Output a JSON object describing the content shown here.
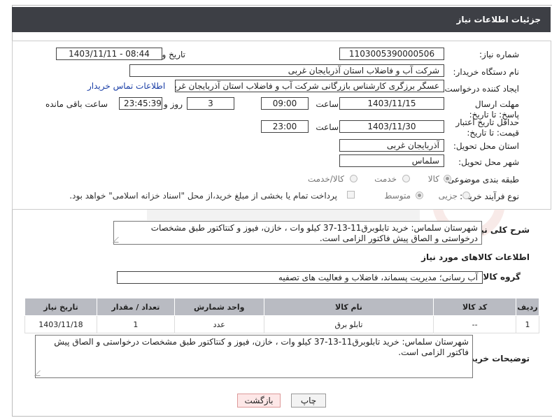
{
  "header": {
    "title": "جزئیات اطلاعات نیاز"
  },
  "form": {
    "need_number_label": "شماره نیاز:",
    "need_number": "1103005390000506",
    "announce_label": "تاریخ و ساعت اعلان عمومی:",
    "announce_value": "1403/11/11 - 08:44",
    "buyer_label": "نام دستگاه خریدار:",
    "buyer_value": "شرکت آب و فاضلاب استان آذربایجان غربی",
    "creator_label": "ایجاد کننده درخواست:",
    "creator_value": "عسگر  برزگری کارشناس بازرگانی شرکت آب و فاضلاب استان آذربایجان غربی",
    "contact_link": "اطلاعات تماس خریدار",
    "deadline_label": "مهلت ارسال پاسخ: تا تاریخ:",
    "deadline_date": "1403/11/15",
    "time_label": "ساعت",
    "deadline_time": "09:00",
    "days_value": "3",
    "days_label": "روز و",
    "remaining_time": "23:45:39",
    "remaining_label": "ساعت باقی مانده",
    "validity_label": "حداقل تاریخ اعتبار قیمت: تا تاریخ:",
    "validity_date": "1403/11/30",
    "validity_time": "23:00",
    "province_label": "استان محل تحویل:",
    "province_value": "آذربایجان غربی",
    "city_label": "شهر محل تحویل:",
    "city_value": "سلماس",
    "category_label": "طبقه بندی موضوعی:",
    "category_options": [
      "کالا",
      "خدمت",
      "کالا/خدمت"
    ],
    "process_label": "نوع فرآیند خرید :",
    "process_options": [
      "جزیی",
      "متوسط"
    ],
    "payment_note": "پرداخت تمام یا بخشی از مبلغ خرید،از محل \"اسناد خزانه اسلامی\" خواهد بود."
  },
  "description": {
    "label": "شرح کلی نیاز:",
    "text": "شهرستان سلماس: خرید تابلوبرق11-13-37 کیلو وات ، خازن، فیوز و کنتاکتور طبق مشخصات درخواستی و الصاق پیش فاکتور الزامی است."
  },
  "goods": {
    "section_title": "اطلاعات کالاهای مورد نیاز",
    "group_label": "گروه کالا:",
    "group_value": "آب رسانی؛ مدیریت پسماند، فاضلاب و فعالیت های تصفیه",
    "columns": [
      "ردیف",
      "کد کالا",
      "نام کالا",
      "واحد شمارش",
      "تعداد / مقدار",
      "تاریخ نیاز"
    ],
    "rows": [
      {
        "row": "1",
        "code": "--",
        "name": "تابلو برق",
        "unit": "عدد",
        "qty": "1",
        "date": "1403/11/18"
      }
    ]
  },
  "buyer_notes": {
    "label": "توضیحات خریدار:",
    "text": "شهرستان سلماس: خرید تابلوبرق11-13-37 کیلو وات ، خازن، فیوز و کنتاکتور طبق مشخصات درخواستی و الصاق پیش فاکتور الزامی است."
  },
  "buttons": {
    "print": "چاپ",
    "back": "بازگشت"
  },
  "colors": {
    "header_bg": "#3d3f45",
    "table_header_bg": "#b9bbc2",
    "link": "#1a3ea6"
  }
}
